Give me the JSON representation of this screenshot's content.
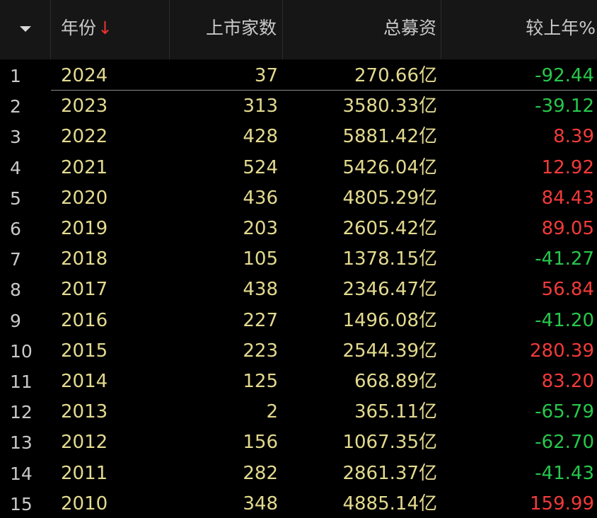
{
  "header": {
    "menu_icon": "caret-down-icon",
    "year_label": "年份",
    "sort_indicator": "↓",
    "count_label": "上市家数",
    "raised_label": "总募资",
    "change_label": "较上年%"
  },
  "colors": {
    "up": "#f23a3a",
    "down": "#27c74b",
    "value": "#e3da8f",
    "sort_arrow": "#e8332e"
  },
  "rows": [
    {
      "idx": "1",
      "year": "2024",
      "count": "37",
      "raised": "270.66亿",
      "change": "-92.44",
      "dir": "down"
    },
    {
      "idx": "2",
      "year": "2023",
      "count": "313",
      "raised": "3580.33亿",
      "change": "-39.12",
      "dir": "down"
    },
    {
      "idx": "3",
      "year": "2022",
      "count": "428",
      "raised": "5881.42亿",
      "change": "8.39",
      "dir": "up"
    },
    {
      "idx": "4",
      "year": "2021",
      "count": "524",
      "raised": "5426.04亿",
      "change": "12.92",
      "dir": "up"
    },
    {
      "idx": "5",
      "year": "2020",
      "count": "436",
      "raised": "4805.29亿",
      "change": "84.43",
      "dir": "up"
    },
    {
      "idx": "6",
      "year": "2019",
      "count": "203",
      "raised": "2605.42亿",
      "change": "89.05",
      "dir": "up"
    },
    {
      "idx": "7",
      "year": "2018",
      "count": "105",
      "raised": "1378.15亿",
      "change": "-41.27",
      "dir": "down"
    },
    {
      "idx": "8",
      "year": "2017",
      "count": "438",
      "raised": "2346.47亿",
      "change": "56.84",
      "dir": "up"
    },
    {
      "idx": "9",
      "year": "2016",
      "count": "227",
      "raised": "1496.08亿",
      "change": "-41.20",
      "dir": "down"
    },
    {
      "idx": "10",
      "year": "2015",
      "count": "223",
      "raised": "2544.39亿",
      "change": "280.39",
      "dir": "up"
    },
    {
      "idx": "11",
      "year": "2014",
      "count": "125",
      "raised": "668.89亿",
      "change": "83.20",
      "dir": "up"
    },
    {
      "idx": "12",
      "year": "2013",
      "count": "2",
      "raised": "365.11亿",
      "change": "-65.79",
      "dir": "down"
    },
    {
      "idx": "13",
      "year": "2012",
      "count": "156",
      "raised": "1067.35亿",
      "change": "-62.70",
      "dir": "down"
    },
    {
      "idx": "14",
      "year": "2011",
      "count": "282",
      "raised": "2861.37亿",
      "change": "-41.43",
      "dir": "down"
    },
    {
      "idx": "15",
      "year": "2010",
      "count": "348",
      "raised": "4885.14亿",
      "change": "159.99",
      "dir": "up"
    }
  ]
}
